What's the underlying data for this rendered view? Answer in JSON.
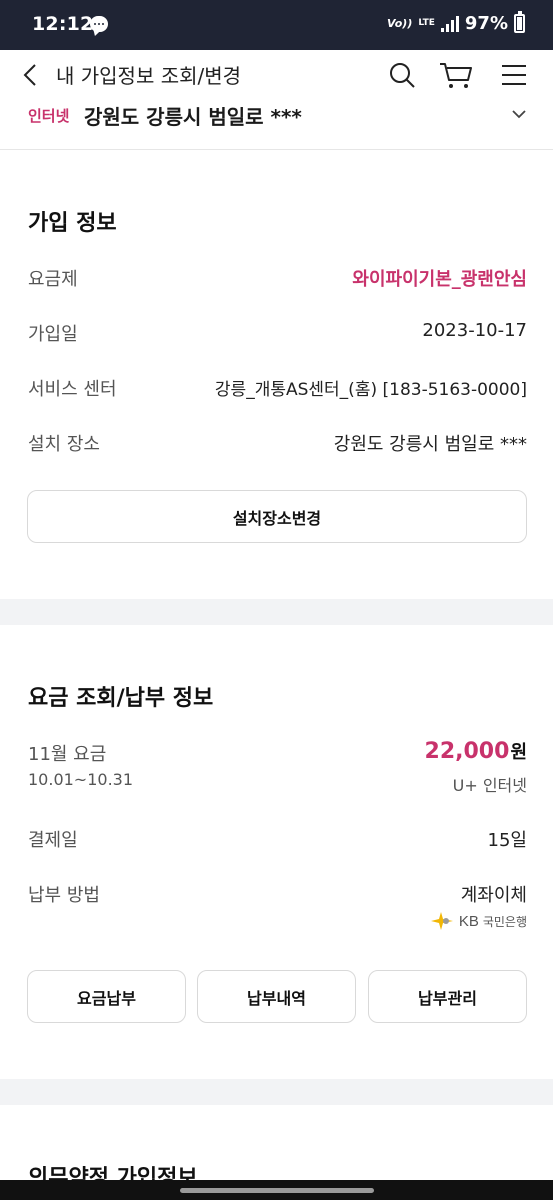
{
  "status_bar": {
    "time": "12:12",
    "network_volte": "Vo))",
    "network_lte": "LTE",
    "battery": "97%"
  },
  "header": {
    "title": "내 가입정보 조회/변경",
    "icons": [
      "back-icon",
      "search-icon",
      "cart-icon",
      "menu-icon"
    ]
  },
  "address_bar": {
    "tag": "인터넷",
    "address": "강원도 강릉시 범일로 ***"
  },
  "subscription": {
    "title": "가입 정보",
    "rows": [
      {
        "label": "요금제",
        "value": "와이파이기본_광랜안심"
      },
      {
        "label": "가입일",
        "value": "2023-10-17"
      },
      {
        "label": "서비스 센터",
        "value": "강릉_개통AS센터_(홈) [183-5163-0000]"
      },
      {
        "label": "설치 장소",
        "value": "강원도 강릉시 범일로 ***"
      }
    ],
    "change_button": "설치장소변경"
  },
  "billing": {
    "title": "요금 조회/납부 정보",
    "month_label": "11월 요금",
    "period": "10.01~10.31",
    "amount": "22,000",
    "amount_unit": "원",
    "product": "U+ 인터넷",
    "pay_day_label": "결제일",
    "pay_day": "15일",
    "method_label": "납부 방법",
    "method": "계좌이체",
    "bank_logo": "KB",
    "bank_name": "국민은행",
    "buttons": [
      "요금납부",
      "납부내역",
      "납부관리"
    ]
  },
  "next_section": {
    "title": "의무약정 가입정보"
  },
  "colors": {
    "accent": "#c8326b",
    "status_bar": "#1f2434",
    "divider": "#f2f3f5"
  }
}
